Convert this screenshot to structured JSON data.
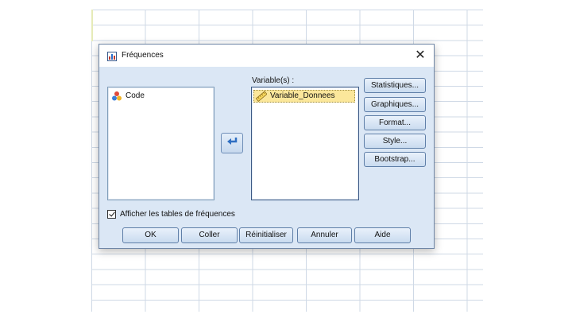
{
  "dialog": {
    "title": "Fréquences",
    "close_symbol": "✕"
  },
  "source_list": {
    "items": [
      {
        "label": "Code",
        "icon": "nominal-variable-icon"
      }
    ]
  },
  "target_list": {
    "label": "Variable(s) :",
    "items": [
      {
        "label": "Variable_Donnees",
        "icon": "scale-variable-icon",
        "selected": true
      }
    ]
  },
  "side_buttons": {
    "statistics": "Statistiques...",
    "charts": "Graphiques...",
    "format": "Format...",
    "style": "Style...",
    "bootstrap": "Bootstrap..."
  },
  "checkbox": {
    "label": "Afficher les tables de fréquences",
    "checked": true
  },
  "bottom_buttons": {
    "ok": "OK",
    "paste": "Coller",
    "reset": "Réinitialiser",
    "cancel": "Annuler",
    "help": "Aide"
  },
  "colors": {
    "dialog_bg": "#dbe7f5",
    "selection": "#fbe79b",
    "arrow": "#2f6fc2"
  }
}
